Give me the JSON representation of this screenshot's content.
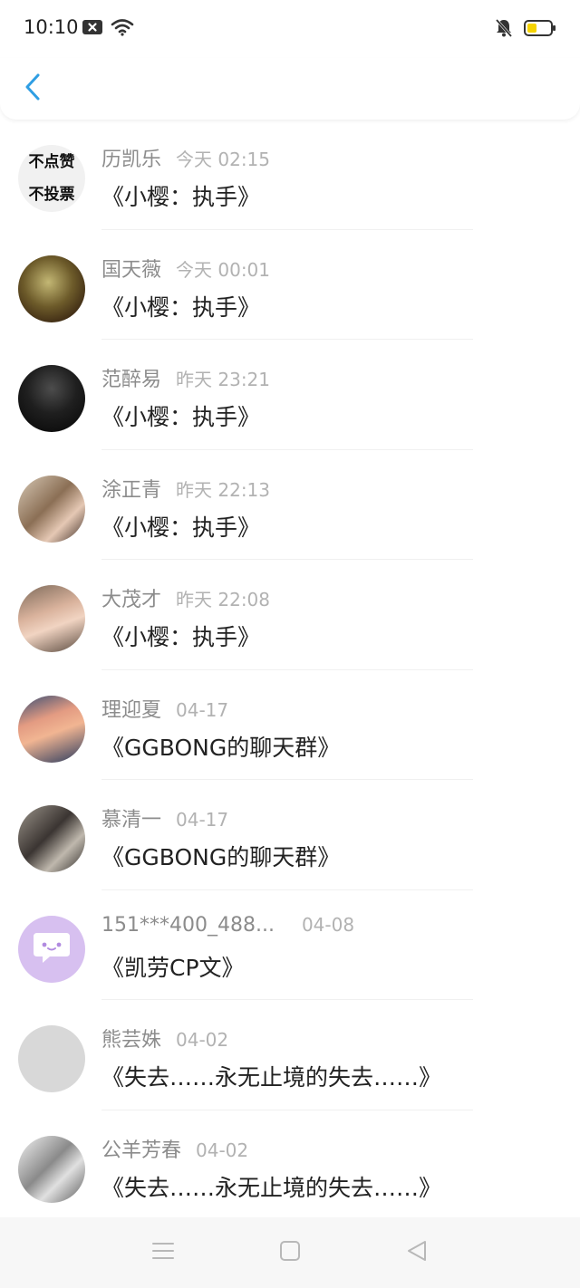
{
  "status_bar": {
    "time": "10:10",
    "icons_left": [
      "notification-x-icon",
      "wifi-icon"
    ],
    "icons_right": [
      "bell-off-icon",
      "battery-icon"
    ],
    "battery_color": "#f5d300"
  },
  "header": {
    "back_icon": "chevron-left-icon",
    "accent_color": "#2f9ee3"
  },
  "items": [
    {
      "name": "历凯乐",
      "time": "今天 02:15",
      "message": "《小樱：执手》",
      "avatar_text": [
        "不点赞",
        "不投票"
      ]
    },
    {
      "name": "国天薇",
      "time": "今天 00:01",
      "message": "《小樱：执手》"
    },
    {
      "name": "范醉易",
      "time": "昨天 23:21",
      "message": "《小樱：执手》"
    },
    {
      "name": "涂正青",
      "time": "昨天 22:13",
      "message": "《小樱：执手》"
    },
    {
      "name": "大茂才",
      "time": "昨天 22:08",
      "message": "《小樱：执手》"
    },
    {
      "name": "理迎夏",
      "time": "04-17",
      "message": "《GGBONG的聊天群》"
    },
    {
      "name": "慕清一",
      "time": "04-17",
      "message": "《GGBONG的聊天群》"
    },
    {
      "name": "151***400_488...",
      "time": "04-08",
      "message": "《凯劳CP文》"
    },
    {
      "name": "熊芸姝",
      "time": "04-02",
      "message": "《失去……永无止境的失去……》"
    },
    {
      "name": "公羊芳春",
      "time": "04-02",
      "message": "《失去……永无止境的失去……》"
    }
  ],
  "nav_bar": {
    "icons": [
      "menu-icon",
      "home-square-icon",
      "back-triangle-icon"
    ]
  }
}
